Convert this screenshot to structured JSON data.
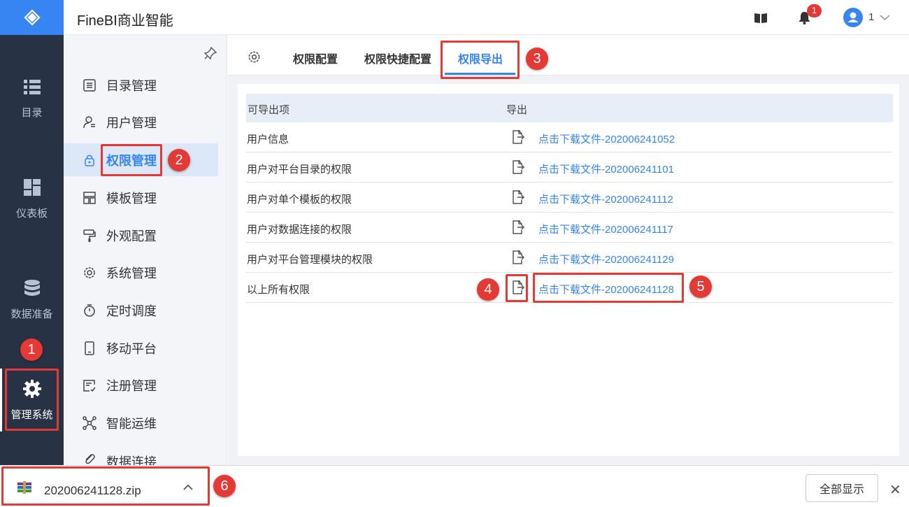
{
  "header": {
    "app_title": "FineBI商业智能",
    "notification_count": "1",
    "user_name": "1"
  },
  "rail": {
    "items": [
      {
        "label": "目录",
        "icon": "list-icon"
      },
      {
        "label": "仪表板",
        "icon": "dashboard-icon"
      },
      {
        "label": "数据准备",
        "icon": "database-icon"
      },
      {
        "label": "管理系统",
        "icon": "gear-icon"
      }
    ]
  },
  "menu": {
    "items": [
      {
        "label": "目录管理",
        "icon": "catalog-icon"
      },
      {
        "label": "用户管理",
        "icon": "user-icon"
      },
      {
        "label": "权限管理",
        "icon": "lock-icon"
      },
      {
        "label": "模板管理",
        "icon": "template-icon"
      },
      {
        "label": "外观配置",
        "icon": "paint-icon"
      },
      {
        "label": "系统管理",
        "icon": "gear-icon"
      },
      {
        "label": "定时调度",
        "icon": "timer-icon"
      },
      {
        "label": "移动平台",
        "icon": "mobile-icon"
      },
      {
        "label": "注册管理",
        "icon": "register-icon"
      },
      {
        "label": "智能运维",
        "icon": "ops-icon"
      },
      {
        "label": "数据连接",
        "icon": "link-icon"
      }
    ],
    "active_index": 2
  },
  "tabs": [
    {
      "label": "权限配置"
    },
    {
      "label": "权限快捷配置"
    },
    {
      "label": "权限导出"
    }
  ],
  "table": {
    "columns": [
      "可导出项",
      "导出"
    ],
    "rows": [
      {
        "name": "用户信息",
        "link": "点击下载文件-202006241052"
      },
      {
        "name": "用户对平台目录的权限",
        "link": "点击下载文件-202006241101"
      },
      {
        "name": "用户对单个模板的权限",
        "link": "点击下载文件-202006241112"
      },
      {
        "name": "用户对数据连接的权限",
        "link": "点击下载文件-202006241117"
      },
      {
        "name": "用户对平台管理模块的权限",
        "link": "点击下载文件-202006241129"
      },
      {
        "name": "以上所有权限",
        "link": "点击下载文件-202006241128"
      }
    ]
  },
  "download_bar": {
    "file_name": "202006241128.zip",
    "show_all_label": "全部显示"
  },
  "annotations": [
    "1",
    "2",
    "3",
    "4",
    "5",
    "6"
  ],
  "colors": {
    "accent": "#3685f2",
    "annotation": "#e53935",
    "rail_bg": "#283245"
  }
}
